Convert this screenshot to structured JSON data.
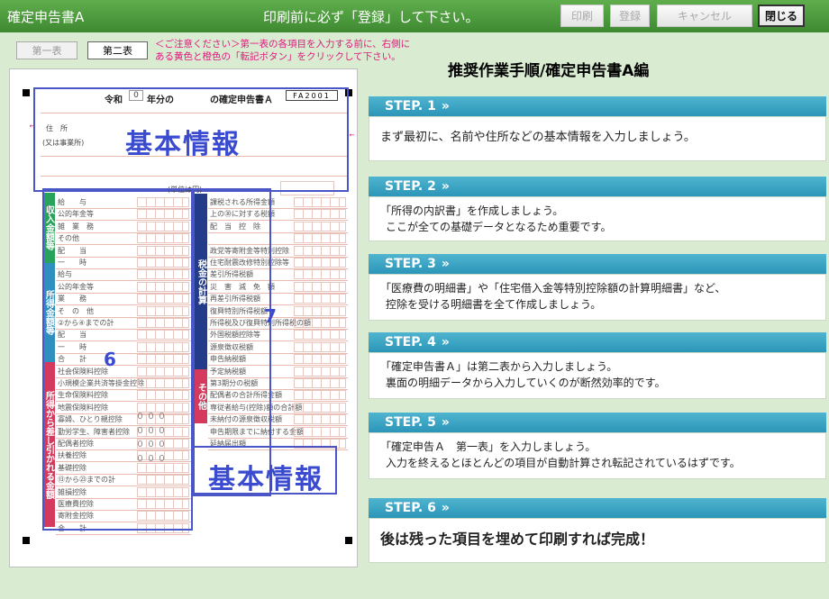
{
  "window": {
    "title": "確定申告書A",
    "notice": "印刷前に必ず「登録」して下さい。",
    "buttons": {
      "print": "印刷",
      "register": "登録",
      "cancel": "キャンセル",
      "close": "閉じる"
    }
  },
  "tabs": {
    "sheet1": "第一表",
    "sheet2": "第二表"
  },
  "caution": "＜ご注意ください＞第一表の各項目を入力する前に、右側にある黄色と橙色の「転記ボタン」をクリックして下さい。",
  "form": {
    "header": {
      "era": "令和",
      "year": "0",
      "title_suffix": "年分の",
      "title": "の確定申告書Ａ",
      "code": "FA2001"
    },
    "labels": {
      "address": "住　所",
      "business": "(又は事業所)",
      "kihon1": "基本情報",
      "kihon2": "基本情報",
      "num6": "6",
      "num7": "7",
      "unit": "(単位は円)"
    },
    "bands": {
      "income": "収入金額等",
      "shotoku": "所得金額等",
      "deduction": "所得から差し引かれる金額",
      "tax": "税金の計算",
      "other": "その他"
    },
    "left_rows": [
      "給　　与",
      "公的年金等",
      "雑　業　務",
      "その他",
      "配　　当",
      "一　　時",
      "給与",
      "公的年金等",
      "業　　務",
      "そ　の　他",
      "②から④までの計",
      "配　　当",
      "一　　時",
      "合　　計",
      "社会保険料控除",
      "小規模企業共済等掛金控除",
      "生命保険料控除",
      "地震保険料控除",
      "寡婦、ひとり親控除",
      "勤労学生、障害者控除",
      "配偶者控除",
      "扶養控除",
      "基礎控除",
      "⑬から㉓までの計",
      "雑損控除",
      "医療費控除",
      "寄附金控除",
      "合　　計"
    ],
    "right_rows": [
      "課税される所得金額",
      "上の㉚に対する税額",
      "配　当　控　除",
      "",
      "政党等寄附金等特別控除",
      "住宅耐震改修特別控除等",
      "差引所得税額",
      "災　害　減　免　額",
      "再差引所得税額",
      "復興特別所得税額",
      "所得税及び復興特別所得税の額",
      "外国税額控除等",
      "源泉徴収税額",
      "申告納税額",
      "予定納税額",
      "第3期分の税額",
      "配偶者の合計所得金額",
      "専従者給与(控除)額の合計額",
      "未納付の源泉徴収税額",
      "申告期限までに納付する金額",
      "延納届出額"
    ],
    "zeros": "０００"
  },
  "guide": {
    "title": "推奨作業手順/確定申告書A編",
    "steps": [
      {
        "label": "STEP. 1",
        "lines": [
          "まず最初に、名前や住所などの基本情報を入力しましょう。"
        ]
      },
      {
        "label": "STEP. 2",
        "lines": [
          "「所得の内訳書」を作成しましょう。",
          "ここが全ての基礎データとなるため重要です。"
        ]
      },
      {
        "label": "STEP. 3",
        "lines": [
          "「医療費の明細書」や「住宅借入金等特別控除額の計算明細書」など、",
          "控除を受ける明細書を全て作成しましょう。"
        ]
      },
      {
        "label": "STEP. 4",
        "lines": [
          "「確定申告書Ａ」は第二表から入力しましょう。",
          "裏面の明細データから入力していくのが断然効率的です。"
        ]
      },
      {
        "label": "STEP. 5",
        "lines": [
          "「確定申告Ａ　第一表」を入力しましょう。",
          "入力を終えるとほとんどの項目が自動計算され転記されているはずです。"
        ]
      },
      {
        "label": "STEP. 6",
        "lines": [
          "後は残った項目を埋めて印刷すれば完成！"
        ]
      }
    ],
    "chevron": "»"
  }
}
